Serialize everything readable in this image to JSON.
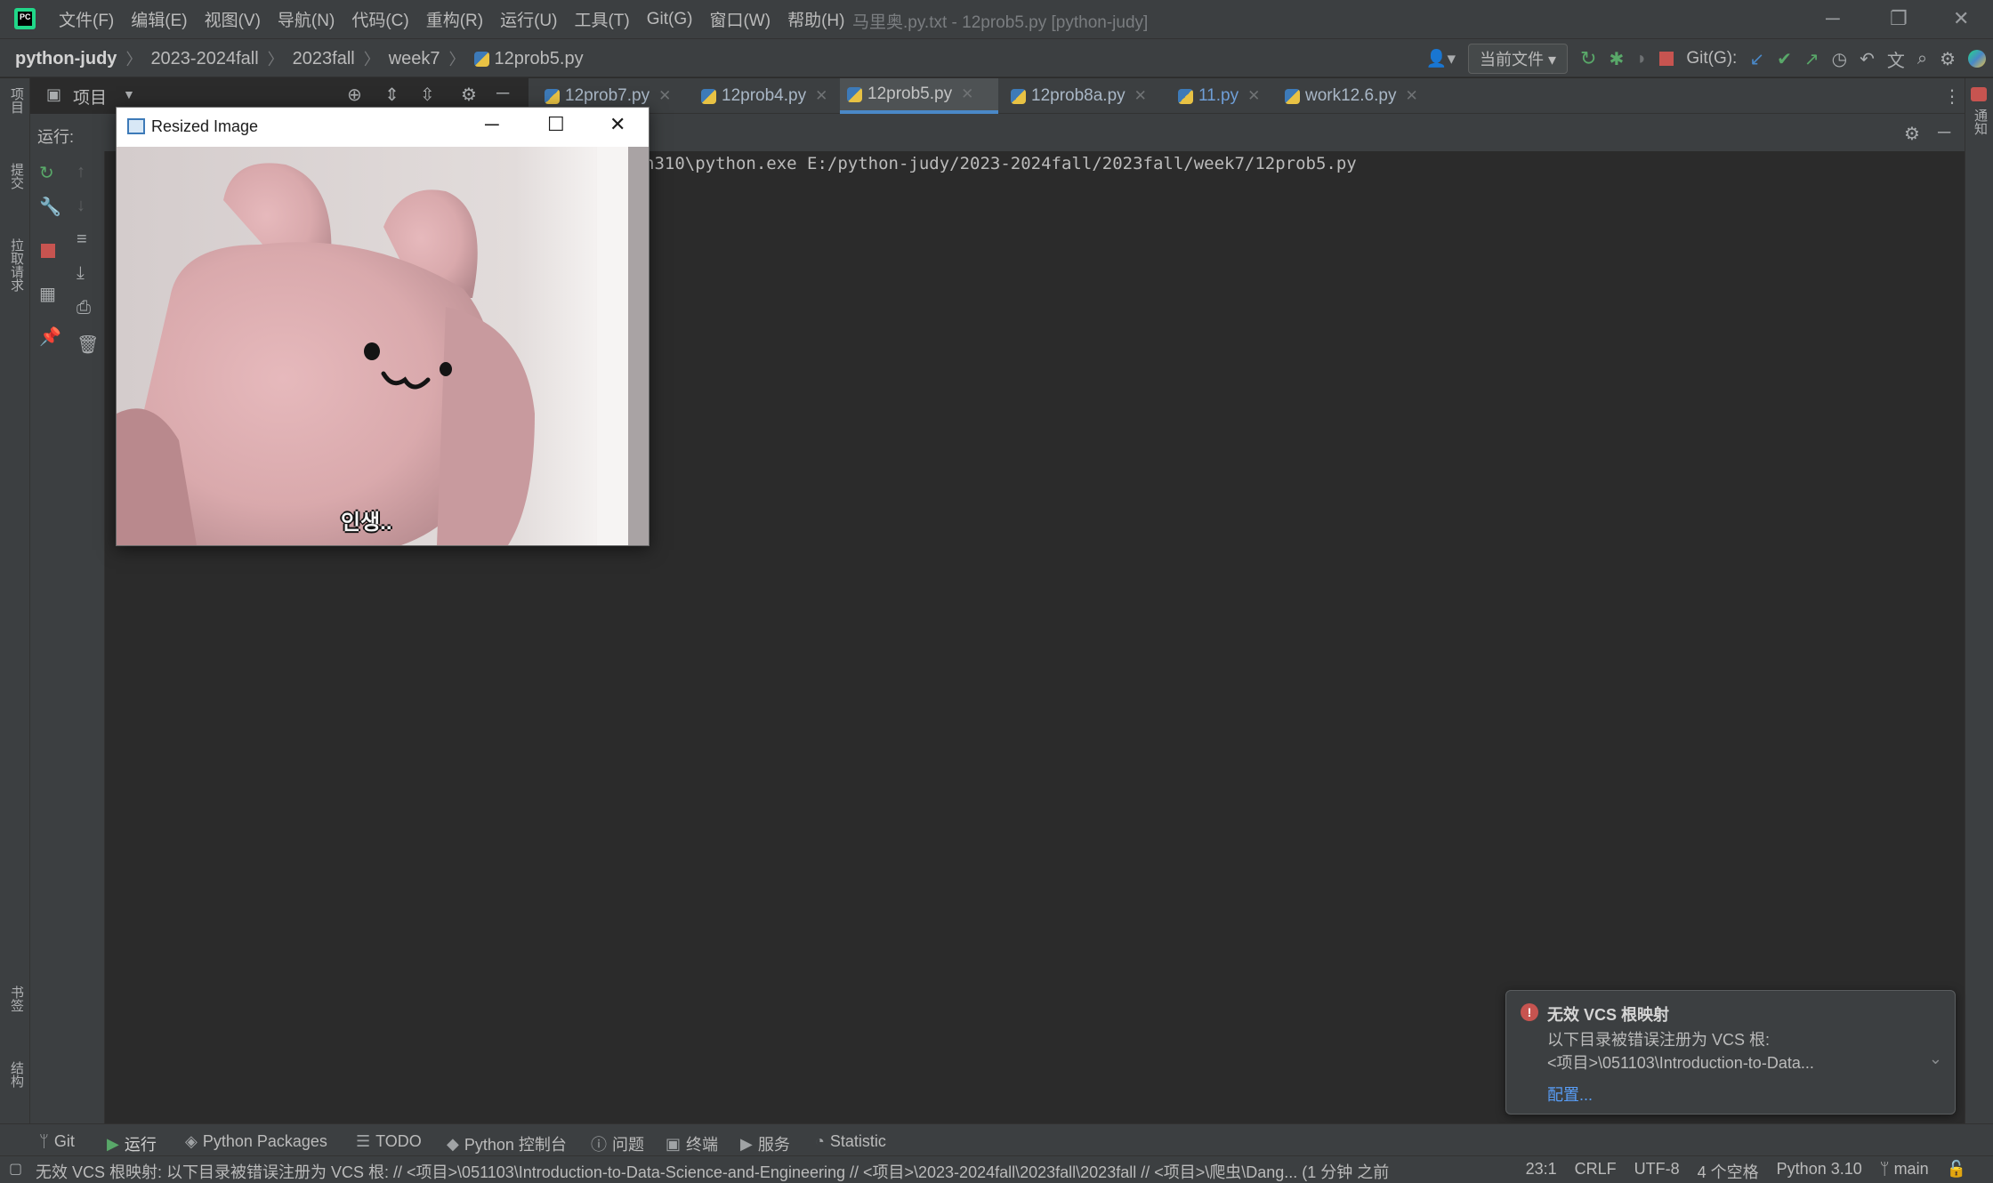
{
  "titlebar": {
    "menu": [
      "文件(F)",
      "编辑(E)",
      "视图(V)",
      "导航(N)",
      "代码(C)",
      "重构(R)",
      "运行(U)",
      "工具(T)",
      "Git(G)",
      "窗口(W)",
      "帮助(H)"
    ],
    "window_title": "马里奥.py.txt - 12prob5.py [python-judy]",
    "logo_text": "PC"
  },
  "navbar": {
    "breadcrumbs": [
      "python-judy",
      "2023-2024fall",
      "2023fall",
      "week7",
      "12prob5.py"
    ],
    "current_file_label": "当前文件",
    "git_label": "Git(G):"
  },
  "project_panel": {
    "label": "项目"
  },
  "tabs": [
    {
      "label": "12prob7.py",
      "active": false
    },
    {
      "label": "12prob4.py",
      "active": false
    },
    {
      "label": "12prob5.py",
      "active": true
    },
    {
      "label": "12prob8a.py",
      "active": false
    },
    {
      "label": "11.py",
      "active": false
    },
    {
      "label": "work12.6.py",
      "active": false
    }
  ],
  "run_panel": {
    "label": "运行:",
    "command": "n310\\python.exe E:/python-judy/2023-2024fall/2023fall/week7/12prob5.py"
  },
  "left_strip": [
    "项目",
    "提交",
    "拉取请求",
    "书签",
    "结构"
  ],
  "right_strip": [
    "通知"
  ],
  "image_window": {
    "title": "Resized Image",
    "caption_text": "인생.."
  },
  "notification": {
    "title": "无效 VCS 根映射",
    "line1": "以下目录被错误注册为 VCS 根:",
    "line2": "<项目>\\051103\\Introduction-to-Data...",
    "link": "配置..."
  },
  "bottom_tools": [
    "Git",
    "运行",
    "Python Packages",
    "TODO",
    "Python 控制台",
    "问题",
    "终端",
    "服务",
    "Statistic"
  ],
  "status": {
    "message": "无效 VCS 根映射: 以下目录被错误注册为 VCS 根: // <项目>\\051103\\Introduction-to-Data-Science-and-Engineering // <项目>\\2023-2024fall\\2023fall\\2023fall // <项目>\\爬虫\\Dang... (1 分钟 之前",
    "position": "23:1",
    "line_sep": "CRLF",
    "encoding": "UTF-8",
    "indent": "4 个空格",
    "interpreter": "Python 3.10",
    "branch": "main"
  },
  "colors": {
    "accent": "#4a88c7",
    "error": "#c75450",
    "link": "#589df6"
  }
}
